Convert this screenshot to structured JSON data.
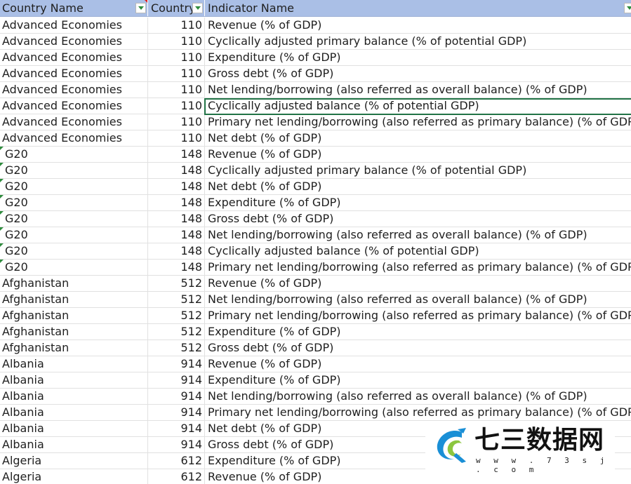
{
  "columns": {
    "country_name": "Country Name",
    "country_code": "Country",
    "indicator_name": "Indicator Name"
  },
  "rows": [
    {
      "name": "Advanced Economies",
      "code": "110",
      "indicator": "Revenue (% of GDP)",
      "flag": false
    },
    {
      "name": "Advanced Economies",
      "code": "110",
      "indicator": "Cyclically adjusted primary balance (% of potential GDP)",
      "flag": false
    },
    {
      "name": "Advanced Economies",
      "code": "110",
      "indicator": "Expenditure (% of GDP)",
      "flag": false
    },
    {
      "name": "Advanced Economies",
      "code": "110",
      "indicator": "Gross debt (% of GDP)",
      "flag": false
    },
    {
      "name": "Advanced Economies",
      "code": "110",
      "indicator": "Net lending/borrowing (also referred as overall balance) (% of GDP)",
      "flag": false
    },
    {
      "name": "Advanced Economies",
      "code": "110",
      "indicator": "Cyclically adjusted balance (% of potential GDP)",
      "flag": false
    },
    {
      "name": "Advanced Economies",
      "code": "110",
      "indicator": "Primary net lending/borrowing (also referred as primary balance) (% of GDP)",
      "flag": false
    },
    {
      "name": "Advanced Economies",
      "code": "110",
      "indicator": "Net debt (% of GDP)",
      "flag": false
    },
    {
      "name": "G20",
      "code": "148",
      "indicator": "Revenue (% of GDP)",
      "flag": true
    },
    {
      "name": "G20",
      "code": "148",
      "indicator": "Cyclically adjusted primary balance (% of potential GDP)",
      "flag": true
    },
    {
      "name": "G20",
      "code": "148",
      "indicator": "Net debt (% of GDP)",
      "flag": true
    },
    {
      "name": "G20",
      "code": "148",
      "indicator": "Expenditure (% of GDP)",
      "flag": true
    },
    {
      "name": "G20",
      "code": "148",
      "indicator": "Gross debt (% of GDP)",
      "flag": true
    },
    {
      "name": "G20",
      "code": "148",
      "indicator": "Net lending/borrowing (also referred as overall balance) (% of GDP)",
      "flag": true
    },
    {
      "name": "G20",
      "code": "148",
      "indicator": "Cyclically adjusted balance (% of potential GDP)",
      "flag": true
    },
    {
      "name": "G20",
      "code": "148",
      "indicator": "Primary net lending/borrowing (also referred as primary balance) (% of GDP)",
      "flag": true
    },
    {
      "name": "Afghanistan",
      "code": "512",
      "indicator": "Revenue (% of GDP)",
      "flag": false
    },
    {
      "name": "Afghanistan",
      "code": "512",
      "indicator": "Net lending/borrowing (also referred as overall balance) (% of GDP)",
      "flag": false
    },
    {
      "name": "Afghanistan",
      "code": "512",
      "indicator": "Primary net lending/borrowing (also referred as primary balance) (% of GDP)",
      "flag": false
    },
    {
      "name": "Afghanistan",
      "code": "512",
      "indicator": "Expenditure (% of GDP)",
      "flag": false
    },
    {
      "name": "Afghanistan",
      "code": "512",
      "indicator": "Gross debt (% of GDP)",
      "flag": false
    },
    {
      "name": "Albania",
      "code": "914",
      "indicator": "Revenue (% of GDP)",
      "flag": false
    },
    {
      "name": "Albania",
      "code": "914",
      "indicator": "Expenditure (% of GDP)",
      "flag": false
    },
    {
      "name": "Albania",
      "code": "914",
      "indicator": "Net lending/borrowing (also referred as overall balance) (% of GDP)",
      "flag": false
    },
    {
      "name": "Albania",
      "code": "914",
      "indicator": "Primary net lending/borrowing (also referred as primary balance) (% of GDP)",
      "flag": false
    },
    {
      "name": "Albania",
      "code": "914",
      "indicator": "Net debt (% of GDP)",
      "flag": false
    },
    {
      "name": "Albania",
      "code": "914",
      "indicator": "Gross debt (% of GDP)",
      "flag": false
    },
    {
      "name": "Algeria",
      "code": "612",
      "indicator": "Expenditure (% of GDP)",
      "flag": false
    },
    {
      "name": "Algeria",
      "code": "612",
      "indicator": "Revenue (% of GDP)",
      "flag": false
    }
  ],
  "selected_row": 5,
  "watermark": {
    "title": "七三数据网",
    "url": "w w w . 7 3 s j . c o m"
  },
  "colors": {
    "header_bg": "#aabfe6",
    "selection": "#217346",
    "filter_arrow": "#2e8b3d",
    "comment_flag": "#e02020"
  },
  "icons": {
    "filter": "filter-dropdown-icon",
    "comment": "comment-indicator-icon",
    "error": "error-indicator-icon",
    "logo": "dragon-logo-icon"
  }
}
